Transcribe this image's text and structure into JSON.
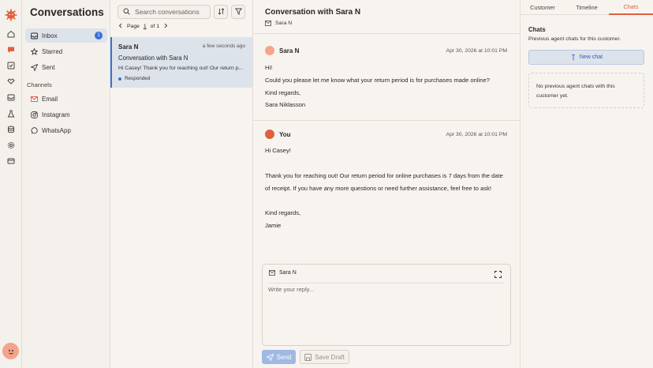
{
  "icons": {
    "rail": [
      "logo-icon",
      "home-icon",
      "chat-icon",
      "checkbox-icon",
      "handshake-icon",
      "inbox-tray-icon",
      "flask-icon",
      "database-icon",
      "settings-icon",
      "card-icon"
    ],
    "accent": "#e0603c",
    "link": "#3b6fd6"
  },
  "nav": {
    "title": "Conversations",
    "items": [
      {
        "label": "Inbox",
        "icon": "inbox-icon",
        "badge": "1"
      },
      {
        "label": "Starred",
        "icon": "star-icon"
      },
      {
        "label": "Sent",
        "icon": "send-icon"
      }
    ],
    "channels_title": "Channels",
    "channels": [
      {
        "label": "Email",
        "icon": "gmail-icon"
      },
      {
        "label": "Instagram",
        "icon": "instagram-icon"
      },
      {
        "label": "WhatsApp",
        "icon": "whatsapp-icon"
      }
    ]
  },
  "list": {
    "search_placeholder": "Search conversations",
    "pager": {
      "prefix": "Page",
      "current": "1",
      "suffix": "of 1"
    },
    "conversations": [
      {
        "name": "Sara N",
        "time": "a few seconds ago",
        "subject": "Conversation with Sara N",
        "preview": "Hi Casey! Thank you for reaching out! Our return p...",
        "status": "Responded"
      }
    ]
  },
  "thread": {
    "title": "Conversation with Sara N",
    "contact": "Sara N",
    "messages": [
      {
        "sender": "Sara N",
        "time": "Apr 30, 2026 at 10:01 PM",
        "lines": [
          "Hi!",
          "Could you please let me know what your return period is for purchases made online?",
          "Kind regards,",
          "Sara Niklasson"
        ]
      },
      {
        "sender": "You",
        "time": "Apr 30, 2026 at 10:01 PM",
        "lines": [
          "Hi Casey!",
          "Thank you for reaching out! Our return period for online purchases is 7 days from the date",
          "of receipt. If you have any more questions or need further assistance, feel free to ask!",
          "Kind regards,",
          "Jamie"
        ]
      }
    ],
    "composer": {
      "to": "Sara N",
      "placeholder": "Write your reply...",
      "send_label": "Send",
      "draft_label": "Save Draft"
    }
  },
  "panel": {
    "tabs": [
      "Customer",
      "Timeline",
      "Chats"
    ],
    "active_tab": "Chats",
    "title": "Chats",
    "subtitle": "Previous agent chats for this customer.",
    "new_chat_label": "New chat",
    "empty_text": "No previous agent chats with this customer yet."
  }
}
